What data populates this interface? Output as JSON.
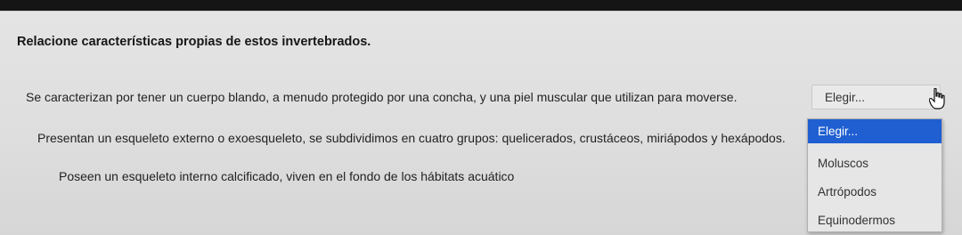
{
  "question": {
    "title": "Relacione características propias de estos invertebrados."
  },
  "rows": [
    {
      "text": "Se caracterizan por tener un cuerpo blando, a menudo protegido por una concha, y una piel muscular que utilizan para moverse."
    },
    {
      "text": "Presentan un esqueleto externo o exoesqueleto, se subdividimos en cuatro grupos: quelicerados, crustáceos, miriápodos y hexápodos."
    },
    {
      "text": "Poseen un esqueleto interno calcificado, viven en el fondo de los hábitats acuático"
    }
  ],
  "select": {
    "value": "Elegir..."
  },
  "dropdown": {
    "options": [
      "Elegir...",
      "Moluscos",
      "Artrópodos",
      "Equinodermos"
    ],
    "selected_index": 0
  },
  "colors": {
    "highlight": "#1f5fd1",
    "background": "#e0e0e0"
  },
  "icons": {
    "cursor": "hand-pointer-icon"
  }
}
